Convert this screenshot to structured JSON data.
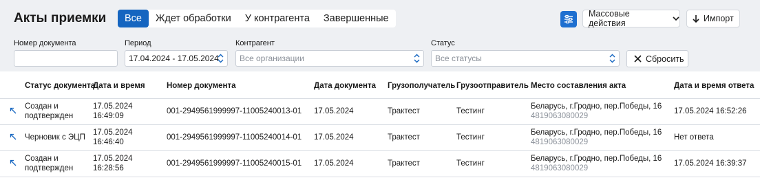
{
  "header": {
    "title": "Акты приемки",
    "tabs": [
      {
        "label": "Все",
        "active": true
      },
      {
        "label": "Ждет обработки",
        "active": false
      },
      {
        "label": "У контрагента",
        "active": false
      },
      {
        "label": "Завершенные",
        "active": false
      }
    ],
    "bulk_actions_label": "Массовые действия",
    "import_label": "Импорт"
  },
  "filters": {
    "doc_number": {
      "label": "Номер документа",
      "value": ""
    },
    "period": {
      "label": "Период",
      "value": "17.04.2024 - 17.05.2024"
    },
    "counterparty": {
      "label": "Контрагент",
      "placeholder": "Все организации"
    },
    "status": {
      "label": "Статус",
      "placeholder": "Все статусы"
    },
    "reset_label": "Сбросить"
  },
  "table": {
    "columns": [
      "Статус документа",
      "Дата и время",
      "Номер документа",
      "Дата документа",
      "Грузополучатель",
      "Грузоотправитель",
      "Место составления акта",
      "Дата и время ответа"
    ],
    "rows": [
      {
        "status_l1": "Создан и",
        "status_l2": "подтвержден",
        "date": "17.05.2024",
        "time": "16:49:09",
        "number": "001-2949561999997-11005240013-01",
        "doc_date": "17.05.2024",
        "consignee": "Трактест",
        "shipper": "Тестинг",
        "place": "Беларусь, г.Гродно, пер.Победы, 16",
        "place_code": "4819063080029",
        "response": "17.05.2024 16:52:26"
      },
      {
        "status_l1": "Черновик с ЭЦП",
        "status_l2": "",
        "date": "17.05.2024",
        "time": "16:46:40",
        "number": "001-2949561999997-11005240014-01",
        "doc_date": "17.05.2024",
        "consignee": "Трактест",
        "shipper": "Тестинг",
        "place": "Беларусь, г.Гродно, пер.Победы, 16",
        "place_code": "4819063080029",
        "response": "Нет ответа"
      },
      {
        "status_l1": "Создан и",
        "status_l2": "подтвержден",
        "date": "17.05.2024",
        "time": "16:28:56",
        "number": "001-2949561999997-11005240015-01",
        "doc_date": "17.05.2024",
        "consignee": "Трактест",
        "shipper": "Тестинг",
        "place": "Беларусь, г.Гродно, пер.Победы, 16",
        "place_code": "4819063080029",
        "response": "17.05.2024 16:39:37"
      }
    ]
  },
  "colors": {
    "accent": "#1565c0",
    "toolbar_bg": "#eef0f3",
    "muted_text": "#8a9099"
  }
}
